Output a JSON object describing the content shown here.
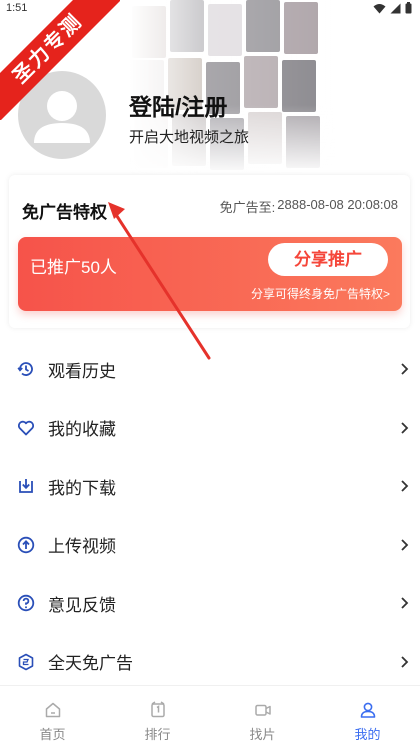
{
  "status_bar": {
    "time": "1:51"
  },
  "watermark": {
    "text": "圣力专测"
  },
  "profile": {
    "title": "登陆/注册",
    "subtitle": "开启大地视频之旅"
  },
  "vip": {
    "title": "免广告特权",
    "expire_label": "免广告至:",
    "expire_value": "2888-08-08 20:08:08",
    "promoted_count": "已推广50人",
    "share_button": "分享推广",
    "share_note": "分享可得终身免广告特权>"
  },
  "menu": {
    "items": [
      {
        "label": "观看历史",
        "icon": "history-icon"
      },
      {
        "label": "我的收藏",
        "icon": "favorite-icon"
      },
      {
        "label": "我的下载",
        "icon": "download-icon"
      },
      {
        "label": "上传视频",
        "icon": "upload-icon"
      },
      {
        "label": "意见反馈",
        "icon": "feedback-icon"
      },
      {
        "label": "全天免广告",
        "icon": "ad-free-icon"
      }
    ]
  },
  "tabs": [
    {
      "label": "首页",
      "icon": "home-icon"
    },
    {
      "label": "排行",
      "icon": "ranking-icon"
    },
    {
      "label": "找片",
      "icon": "video-search-icon"
    },
    {
      "label": "我的",
      "icon": "profile-icon",
      "active": true
    }
  ],
  "colors": {
    "accent": "#3a6df0",
    "promo_start": "#f6534a",
    "promo_end": "#fb7a5d",
    "icon_blue": "#2a4fb8",
    "ribbon": "#e5231c"
  }
}
